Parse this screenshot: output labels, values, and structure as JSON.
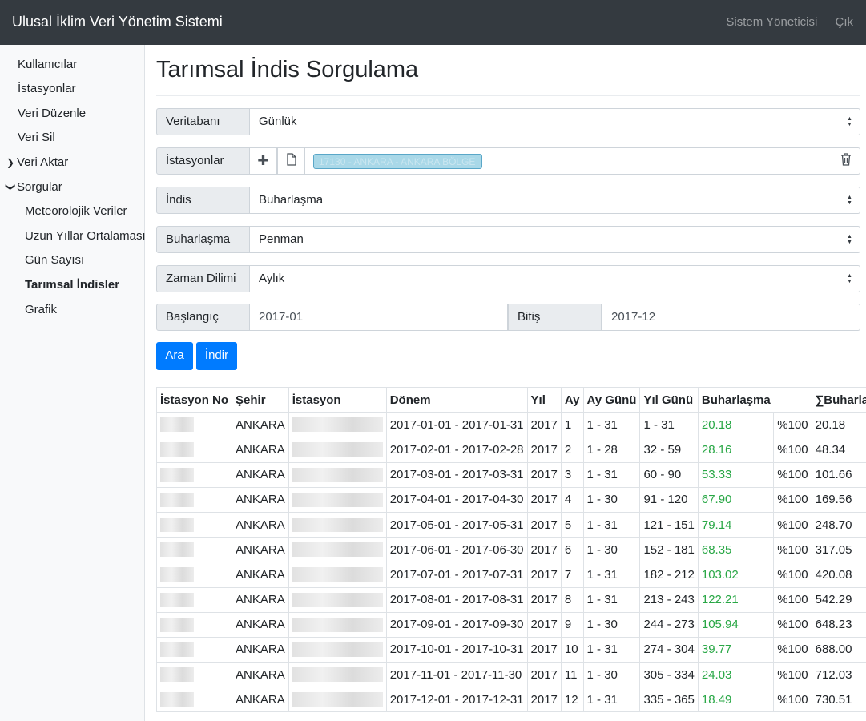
{
  "header": {
    "title": "Ulusal İklim Veri Yönetim Sistemi",
    "user": "Sistem Yöneticisi",
    "logout": "Çık"
  },
  "sidebar": {
    "items": [
      {
        "label": "Kullanıcılar"
      },
      {
        "label": "İstasyonlar"
      },
      {
        "label": "Veri Düzenle"
      },
      {
        "label": "Veri Sil"
      },
      {
        "label": "Veri Aktar",
        "expanded": false
      },
      {
        "label": "Sorgular",
        "expanded": true
      },
      {
        "label": "Meteorolojik Veriler"
      },
      {
        "label": "Uzun Yıllar Ortalaması"
      },
      {
        "label": "Gün Sayısı"
      },
      {
        "label": "Tarımsal İndisler",
        "active": true
      },
      {
        "label": "Grafik"
      }
    ]
  },
  "page": {
    "title": "Tarımsal İndis Sorgulama"
  },
  "form": {
    "database_label": "Veritabanı",
    "database_value": "Günlük",
    "stations_label": "İstasyonlar",
    "station_chip": "17130 - ANKARA - ANKARA BÖLGE",
    "index_label": "İndis",
    "index_value": "Buharlaşma",
    "evap_label": "Buharlaşma",
    "evap_value": "Penman",
    "period_label": "Zaman Dilimi",
    "period_value": "Aylık",
    "start_label": "Başlangıç",
    "start_value": "2017-01",
    "end_label": "Bitiş",
    "end_value": "2017-12",
    "search_button": "Ara",
    "download_button": "İndir"
  },
  "colors": {
    "accent": "#007bff",
    "navbar": "#343a40",
    "positive": "#28a745"
  },
  "table": {
    "headers": [
      "İstasyon No",
      "Şehir",
      "İstasyon",
      "Dönem",
      "Yıl",
      "Ay",
      "Ay Günü",
      "Yıl Günü",
      "Buharlaşma",
      "",
      "∑Buharlaşma"
    ],
    "rows": [
      {
        "city": "ANKARA",
        "period": "2017-01-01 - 2017-01-31",
        "year": "2017",
        "month": "1",
        "month_days": "1 - 31",
        "year_days": "1 - 31",
        "evap": "20.18",
        "pct": "%100",
        "cum": "20.18"
      },
      {
        "city": "ANKARA",
        "period": "2017-02-01 - 2017-02-28",
        "year": "2017",
        "month": "2",
        "month_days": "1 - 28",
        "year_days": "32 - 59",
        "evap": "28.16",
        "pct": "%100",
        "cum": "48.34"
      },
      {
        "city": "ANKARA",
        "period": "2017-03-01 - 2017-03-31",
        "year": "2017",
        "month": "3",
        "month_days": "1 - 31",
        "year_days": "60 - 90",
        "evap": "53.33",
        "pct": "%100",
        "cum": "101.66"
      },
      {
        "city": "ANKARA",
        "period": "2017-04-01 - 2017-04-30",
        "year": "2017",
        "month": "4",
        "month_days": "1 - 30",
        "year_days": "91 - 120",
        "evap": "67.90",
        "pct": "%100",
        "cum": "169.56"
      },
      {
        "city": "ANKARA",
        "period": "2017-05-01 - 2017-05-31",
        "year": "2017",
        "month": "5",
        "month_days": "1 - 31",
        "year_days": "121 - 151",
        "evap": "79.14",
        "pct": "%100",
        "cum": "248.70"
      },
      {
        "city": "ANKARA",
        "period": "2017-06-01 - 2017-06-30",
        "year": "2017",
        "month": "6",
        "month_days": "1 - 30",
        "year_days": "152 - 181",
        "evap": "68.35",
        "pct": "%100",
        "cum": "317.05"
      },
      {
        "city": "ANKARA",
        "period": "2017-07-01 - 2017-07-31",
        "year": "2017",
        "month": "7",
        "month_days": "1 - 31",
        "year_days": "182 - 212",
        "evap": "103.02",
        "pct": "%100",
        "cum": "420.08"
      },
      {
        "city": "ANKARA",
        "period": "2017-08-01 - 2017-08-31",
        "year": "2017",
        "month": "8",
        "month_days": "1 - 31",
        "year_days": "213 - 243",
        "evap": "122.21",
        "pct": "%100",
        "cum": "542.29"
      },
      {
        "city": "ANKARA",
        "period": "2017-09-01 - 2017-09-30",
        "year": "2017",
        "month": "9",
        "month_days": "1 - 30",
        "year_days": "244 - 273",
        "evap": "105.94",
        "pct": "%100",
        "cum": "648.23"
      },
      {
        "city": "ANKARA",
        "period": "2017-10-01 - 2017-10-31",
        "year": "2017",
        "month": "10",
        "month_days": "1 - 31",
        "year_days": "274 - 304",
        "evap": "39.77",
        "pct": "%100",
        "cum": "688.00"
      },
      {
        "city": "ANKARA",
        "period": "2017-11-01 - 2017-11-30",
        "year": "2017",
        "month": "11",
        "month_days": "1 - 30",
        "year_days": "305 - 334",
        "evap": "24.03",
        "pct": "%100",
        "cum": "712.03"
      },
      {
        "city": "ANKARA",
        "period": "2017-12-01 - 2017-12-31",
        "year": "2017",
        "month": "12",
        "month_days": "1 - 31",
        "year_days": "335 - 365",
        "evap": "18.49",
        "pct": "%100",
        "cum": "730.51"
      }
    ]
  }
}
